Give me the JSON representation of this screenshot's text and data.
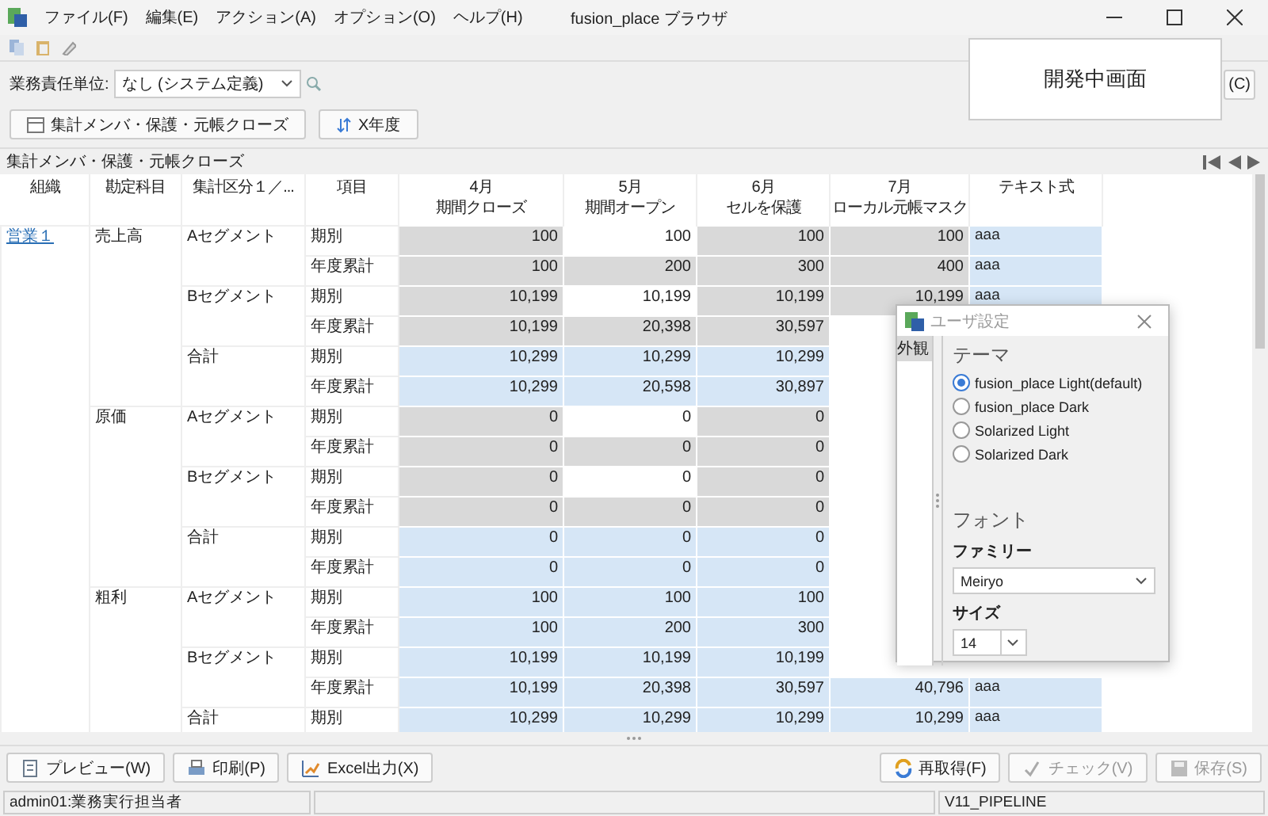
{
  "window": {
    "title": "fusion_place ブラウザ",
    "menus": [
      "ファイル(F)",
      "編集(E)",
      "アクション(A)",
      "オプション(O)",
      "ヘルプ(H)"
    ]
  },
  "filter": {
    "label": "業務責任単位:",
    "value": "なし (システム定義)",
    "button": "(C)"
  },
  "overlay": {
    "text": "開発中画面"
  },
  "view_buttons": [
    {
      "label": "集計メンバ・保護・元帳クローズ",
      "kind": "table"
    },
    {
      "label": "X年度",
      "kind": "sort"
    }
  ],
  "sheet": {
    "title": "集計メンバ・保護・元帳クローズ",
    "columns": [
      {
        "label": "組織"
      },
      {
        "label": "勘定科目"
      },
      {
        "label": "集計区分１／..."
      },
      {
        "label": "項目"
      },
      {
        "month": "4月",
        "label": "期間クローズ",
        "kind": "number"
      },
      {
        "month": "5月",
        "label": "期間オープン",
        "kind": "number"
      },
      {
        "month": "6月",
        "label": "セルを保護",
        "kind": "number"
      },
      {
        "month": "7月",
        "label": "ローカル元帳マスク",
        "kind": "number"
      },
      {
        "label": "テキスト式",
        "kind": "text"
      }
    ],
    "org": "営業１",
    "accounts": [
      {
        "name": "売上高",
        "segments": [
          {
            "name": "Aセグメント",
            "rows": [
              {
                "item": "期別",
                "cells": [
                  {
                    "v": "100",
                    "kind": "gray"
                  },
                  {
                    "v": "100",
                    "kind": "white"
                  },
                  {
                    "v": "100",
                    "kind": "gray"
                  },
                  {
                    "v": "100",
                    "kind": "gray"
                  },
                  {
                    "v": "aaa",
                    "kind": "blue"
                  }
                ]
              },
              {
                "item": "年度累計",
                "cells": [
                  {
                    "v": "100",
                    "kind": "gray"
                  },
                  {
                    "v": "200",
                    "kind": "gray"
                  },
                  {
                    "v": "300",
                    "kind": "gray"
                  },
                  {
                    "v": "400",
                    "kind": "gray"
                  },
                  {
                    "v": "aaa",
                    "kind": "blue"
                  }
                ]
              }
            ]
          },
          {
            "name": "Bセグメント",
            "rows": [
              {
                "item": "期別",
                "cells": [
                  {
                    "v": "10,199",
                    "kind": "gray"
                  },
                  {
                    "v": "10,199",
                    "kind": "white"
                  },
                  {
                    "v": "10,199",
                    "kind": "gray"
                  },
                  {
                    "v": "10,199",
                    "kind": "gray"
                  },
                  {
                    "v": "aaa",
                    "kind": "blue"
                  }
                ]
              },
              {
                "item": "年度累計",
                "cells": [
                  {
                    "v": "10,199",
                    "kind": "gray"
                  },
                  {
                    "v": "20,398",
                    "kind": "gray"
                  },
                  {
                    "v": "30,597",
                    "kind": "gray"
                  },
                  null,
                  null
                ]
              }
            ]
          },
          {
            "name": "合計",
            "rows": [
              {
                "item": "期別",
                "cells": [
                  {
                    "v": "10,299",
                    "kind": "blue"
                  },
                  {
                    "v": "10,299",
                    "kind": "blue"
                  },
                  {
                    "v": "10,299",
                    "kind": "blue"
                  },
                  null,
                  null
                ]
              },
              {
                "item": "年度累計",
                "cells": [
                  {
                    "v": "10,299",
                    "kind": "blue"
                  },
                  {
                    "v": "20,598",
                    "kind": "blue"
                  },
                  {
                    "v": "30,897",
                    "kind": "blue"
                  },
                  null,
                  null
                ]
              }
            ]
          }
        ]
      },
      {
        "name": "原価",
        "segments": [
          {
            "name": "Aセグメント",
            "rows": [
              {
                "item": "期別",
                "cells": [
                  {
                    "v": "0",
                    "kind": "gray"
                  },
                  {
                    "v": "0",
                    "kind": "white"
                  },
                  {
                    "v": "0",
                    "kind": "gray"
                  },
                  null,
                  null
                ]
              },
              {
                "item": "年度累計",
                "cells": [
                  {
                    "v": "0",
                    "kind": "gray"
                  },
                  {
                    "v": "0",
                    "kind": "gray"
                  },
                  {
                    "v": "0",
                    "kind": "gray"
                  },
                  null,
                  null
                ]
              }
            ]
          },
          {
            "name": "Bセグメント",
            "rows": [
              {
                "item": "期別",
                "cells": [
                  {
                    "v": "0",
                    "kind": "gray"
                  },
                  {
                    "v": "0",
                    "kind": "white"
                  },
                  {
                    "v": "0",
                    "kind": "gray"
                  },
                  null,
                  null
                ]
              },
              {
                "item": "年度累計",
                "cells": [
                  {
                    "v": "0",
                    "kind": "gray"
                  },
                  {
                    "v": "0",
                    "kind": "gray"
                  },
                  {
                    "v": "0",
                    "kind": "gray"
                  },
                  null,
                  null
                ]
              }
            ]
          },
          {
            "name": "合計",
            "rows": [
              {
                "item": "期別",
                "cells": [
                  {
                    "v": "0",
                    "kind": "blue"
                  },
                  {
                    "v": "0",
                    "kind": "blue"
                  },
                  {
                    "v": "0",
                    "kind": "blue"
                  },
                  null,
                  null
                ]
              },
              {
                "item": "年度累計",
                "cells": [
                  {
                    "v": "0",
                    "kind": "blue"
                  },
                  {
                    "v": "0",
                    "kind": "blue"
                  },
                  {
                    "v": "0",
                    "kind": "blue"
                  },
                  null,
                  null
                ]
              }
            ]
          }
        ]
      },
      {
        "name": "粗利",
        "segments": [
          {
            "name": "Aセグメント",
            "rows": [
              {
                "item": "期別",
                "cells": [
                  {
                    "v": "100",
                    "kind": "blue"
                  },
                  {
                    "v": "100",
                    "kind": "blue"
                  },
                  {
                    "v": "100",
                    "kind": "blue"
                  },
                  null,
                  null
                ]
              },
              {
                "item": "年度累計",
                "cells": [
                  {
                    "v": "100",
                    "kind": "blue"
                  },
                  {
                    "v": "200",
                    "kind": "blue"
                  },
                  {
                    "v": "300",
                    "kind": "blue"
                  },
                  null,
                  null
                ]
              }
            ]
          },
          {
            "name": "Bセグメント",
            "rows": [
              {
                "item": "期別",
                "cells": [
                  {
                    "v": "10,199",
                    "kind": "blue"
                  },
                  {
                    "v": "10,199",
                    "kind": "blue"
                  },
                  {
                    "v": "10,199",
                    "kind": "blue"
                  },
                  null,
                  null
                ]
              },
              {
                "item": "年度累計",
                "cells": [
                  {
                    "v": "10,199",
                    "kind": "blue"
                  },
                  {
                    "v": "20,398",
                    "kind": "blue"
                  },
                  {
                    "v": "30,597",
                    "kind": "blue"
                  },
                  {
                    "v": "40,796",
                    "kind": "blue"
                  },
                  {
                    "v": "aaa",
                    "kind": "blue"
                  }
                ]
              }
            ]
          },
          {
            "name": "合計",
            "rows": [
              {
                "item": "期別",
                "cells": [
                  {
                    "v": "10,299",
                    "kind": "blue"
                  },
                  {
                    "v": "10,299",
                    "kind": "blue"
                  },
                  {
                    "v": "10,299",
                    "kind": "blue"
                  },
                  {
                    "v": "10,299",
                    "kind": "blue"
                  },
                  {
                    "v": "aaa",
                    "kind": "blue"
                  }
                ]
              }
            ]
          }
        ]
      }
    ]
  },
  "dialog": {
    "title": "ユーザ設定",
    "nav": [
      {
        "label": "外観",
        "selected": true
      }
    ],
    "theme_heading": "テーマ",
    "themes": [
      {
        "label": "fusion_place Light(default)",
        "selected": true
      },
      {
        "label": "fusion_place Dark",
        "selected": false
      },
      {
        "label": "Solarized Light",
        "selected": false
      },
      {
        "label": "Solarized Dark",
        "selected": false
      }
    ],
    "font_heading": "フォント",
    "family_label": "ファミリー",
    "family": "Meiryo",
    "size_label": "サイズ",
    "size": "14"
  },
  "footer": {
    "left": [
      {
        "label": "プレビュー(W)",
        "kind": "preview",
        "disabled": false
      },
      {
        "label": "印刷(P)",
        "kind": "print",
        "disabled": false
      },
      {
        "label": "Excel出力(X)",
        "kind": "excel",
        "disabled": false
      }
    ],
    "right": [
      {
        "label": "再取得(F)",
        "kind": "refresh",
        "disabled": false
      },
      {
        "label": "チェック(V)",
        "kind": "check",
        "disabled": true
      },
      {
        "label": "保存(S)",
        "kind": "save",
        "disabled": true
      }
    ]
  },
  "status_bar": [
    "admin01:業務実行担当者",
    "V11_PIPELINE"
  ]
}
